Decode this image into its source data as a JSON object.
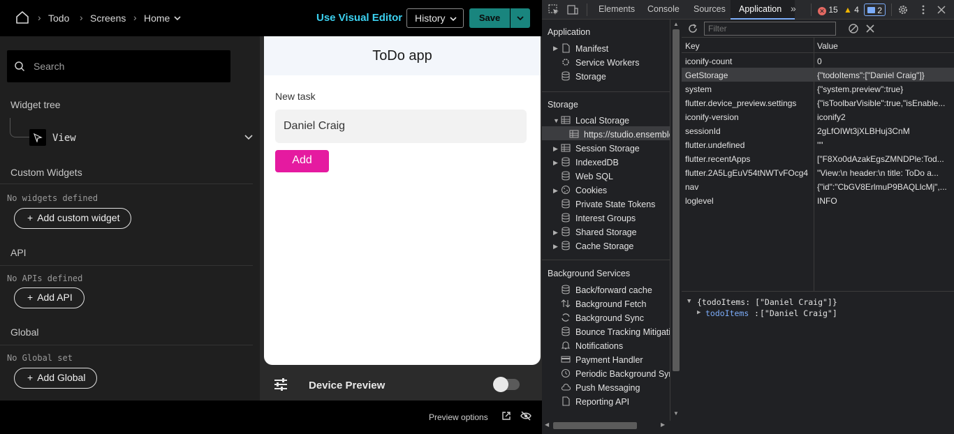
{
  "topbar": {
    "breadcrumbs": [
      "Todo",
      "Screens",
      "Home"
    ],
    "visual_editor": "Use Visual Editor",
    "history_label": "History",
    "save_label": "Save"
  },
  "left_panel": {
    "search_placeholder": "Search",
    "widget_tree_title": "Widget tree",
    "tree_root_label": "View",
    "custom_widgets_title": "Custom Widgets",
    "custom_widgets_empty": "No widgets defined",
    "add_custom_widget": "Add custom widget",
    "api_title": "API",
    "api_empty": "No APIs defined",
    "add_api": "Add API",
    "global_title": "Global",
    "global_empty": "No Global set",
    "add_global": "Add Global"
  },
  "preview": {
    "app_title": "ToDo app",
    "new_task_label": "New task",
    "task_input_value": "Daniel Craig",
    "add_button": "Add",
    "device_preview_label": "Device Preview",
    "device_preview_on": false,
    "preview_options": "Preview options"
  },
  "devtools": {
    "tabs": [
      "Elements",
      "Console",
      "Sources",
      "Application"
    ],
    "active_tab": "Application",
    "errors": "15",
    "warnings": "4",
    "messages": "2",
    "application_section": "Application",
    "application_items": [
      "Manifest",
      "Service Workers",
      "Storage"
    ],
    "storage_section": "Storage",
    "local_storage": "Local Storage",
    "local_storage_origin": "https://studio.ensemble",
    "storage_items": [
      "Session Storage",
      "IndexedDB",
      "Web SQL",
      "Cookies",
      "Private State Tokens",
      "Interest Groups",
      "Shared Storage",
      "Cache Storage"
    ],
    "background_section": "Background Services",
    "background_items": [
      "Back/forward cache",
      "Background Fetch",
      "Background Sync",
      "Bounce Tracking Mitigatio",
      "Notifications",
      "Payment Handler",
      "Periodic Background Sync",
      "Push Messaging",
      "Reporting API"
    ],
    "filter_placeholder": "Filter",
    "table_headers": [
      "Key",
      "Value"
    ],
    "rows": [
      {
        "key": "iconify-count",
        "value": "0"
      },
      {
        "key": "GetStorage",
        "value": "{\"todoItems\":[\"Daniel Craig\"]}"
      },
      {
        "key": "system",
        "value": "{\"system.preview\":true}"
      },
      {
        "key": "flutter.device_preview.settings",
        "value": "{\"isToolbarVisible\":true,\"isEnable..."
      },
      {
        "key": "iconify-version",
        "value": "iconify2"
      },
      {
        "key": "sessionId",
        "value": "2gLfOIWt3jXLBHuj3CnM"
      },
      {
        "key": "flutter.undefined",
        "value": "\"\""
      },
      {
        "key": "flutter.recentApps",
        "value": "[\"F8Xo0dAzakEgsZMNDPle:Tod..."
      },
      {
        "key": "flutter.2A5LgEuV54tNWTvFOcg4",
        "value": "\"View:\\n header:\\n title: ToDo a..."
      },
      {
        "key": "nav",
        "value": "{\"id\":\"CbGV8ErlmuP9BAQLlcMj\",..."
      },
      {
        "key": "loglevel",
        "value": "INFO"
      }
    ],
    "selected_row": 1,
    "json_summary": "{todoItems: [\"Daniel Craig\"]}",
    "json_key": "todoItems",
    "json_value": "[\"Daniel Craig\"]"
  },
  "colors": {
    "accent_teal": "#19857e",
    "visual_editor": "#3cd1f0",
    "add_button": "#e51aa0",
    "devtools_bg": "#202124"
  }
}
